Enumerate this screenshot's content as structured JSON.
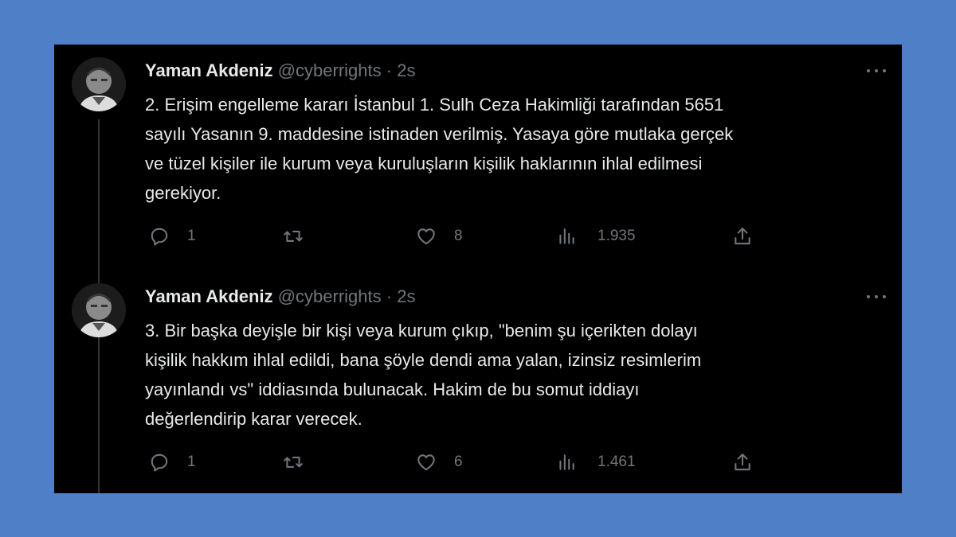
{
  "tweets": [
    {
      "author": {
        "name": "Yaman Akdeniz",
        "handle": "@cyberrights",
        "separator": "·",
        "time": "2s"
      },
      "text_lines": [
        "2. Erişim engelleme kararı İstanbul 1. Sulh Ceza Hakimliği tarafından 5651",
        "sayılı Yasanın 9. maddesine istinaden verilmiş. Yasaya göre mutlaka gerçek",
        "ve tüzel kişiler ile kurum veya kuruluşların kişilik haklarının ihlal edilmesi",
        "gerekiyor."
      ],
      "stats": {
        "replies": "1",
        "retweets": "",
        "likes": "8",
        "views": "1.935"
      }
    },
    {
      "author": {
        "name": "Yaman Akdeniz",
        "handle": "@cyberrights",
        "separator": "·",
        "time": "2s"
      },
      "text_lines": [
        "3. Bir başka deyişle bir kişi veya kurum çıkıp, \"benim şu içerikten dolayı",
        "kişilik hakkım ihlal edildi, bana şöyle dendi ama yalan, izinsiz resimlerim",
        "yayınlandı vs\" iddiasında bulunacak. Hakim de bu somut iddiayı",
        "değerlendirip karar verecek."
      ],
      "stats": {
        "replies": "1",
        "retweets": "",
        "likes": "6",
        "views": "1.461"
      }
    }
  ],
  "icons": {
    "reply": "reply-icon",
    "retweet": "retweet-icon",
    "like": "heart-icon",
    "views": "views-chart-icon",
    "share": "share-icon",
    "more": "more-icon"
  },
  "colors": {
    "background": "#4f7fc6",
    "panel": "#000000",
    "primary_text": "#e7e9ea",
    "secondary_text": "#71767b"
  }
}
